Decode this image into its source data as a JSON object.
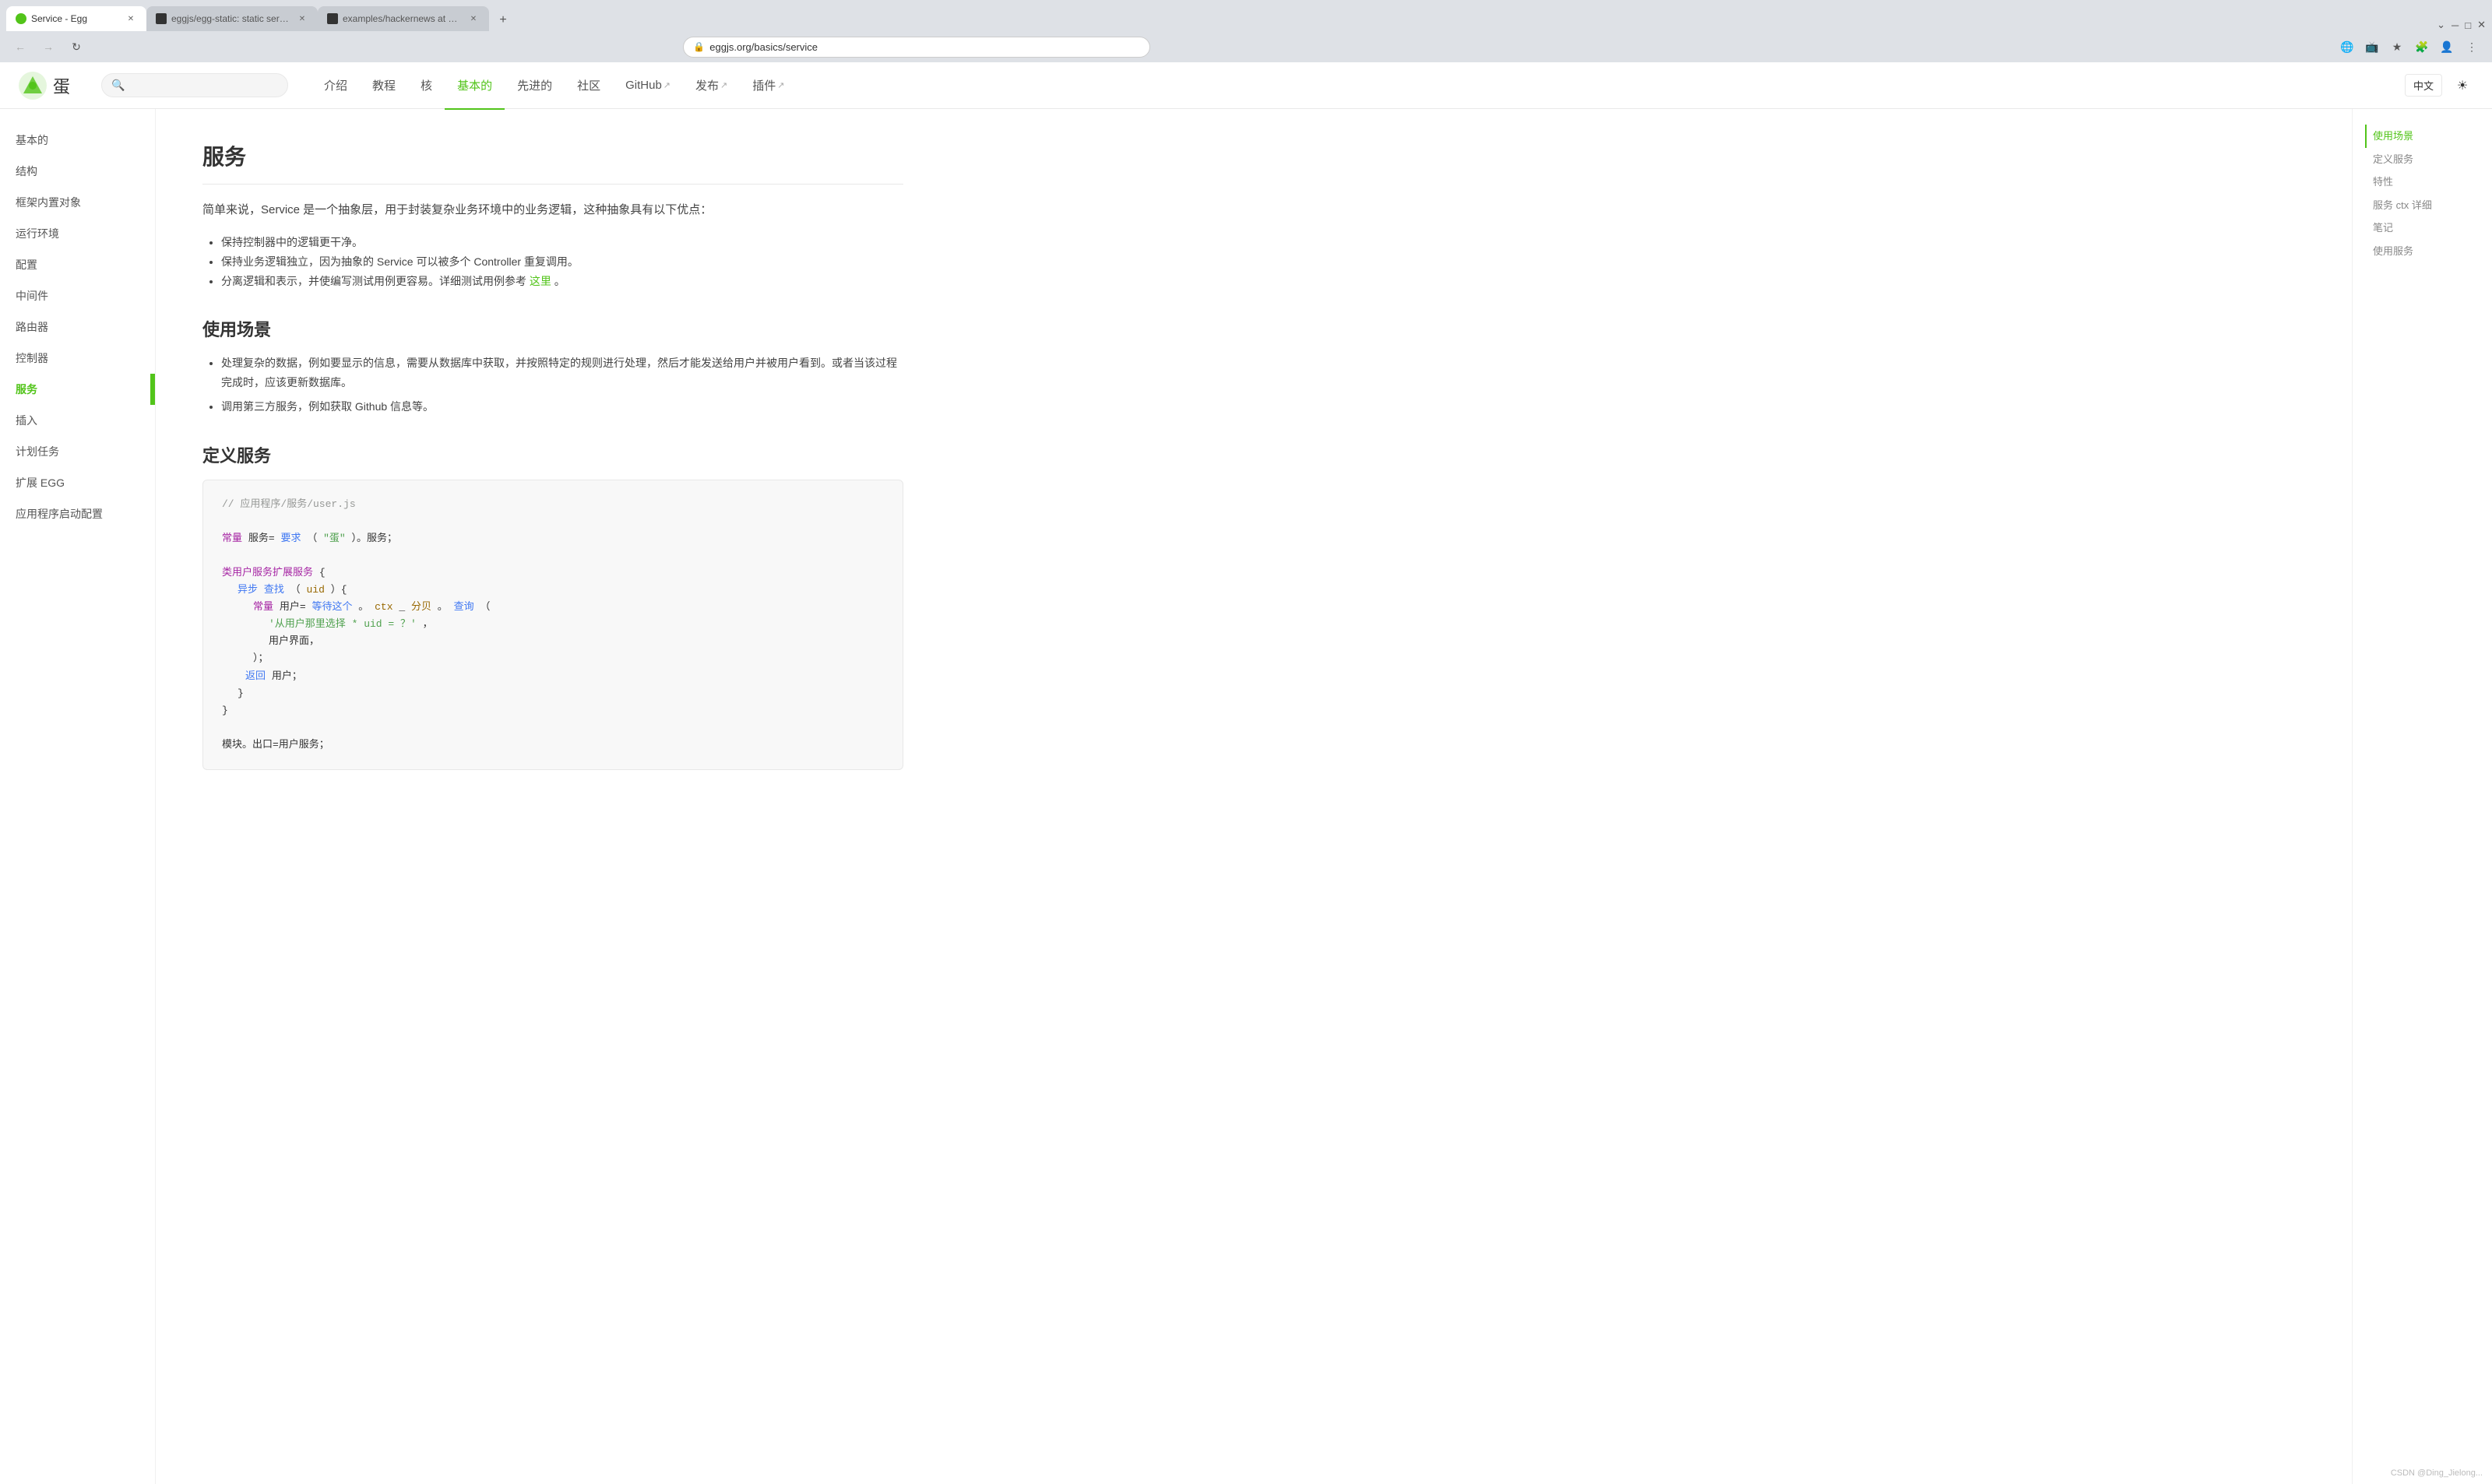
{
  "browser": {
    "tabs": [
      {
        "id": "tab1",
        "favicon_color": "#52c41a",
        "title": "Service - Egg",
        "active": true
      },
      {
        "id": "tab2",
        "favicon_color": "#333",
        "title": "eggjs/egg-static: static server",
        "active": false
      },
      {
        "id": "tab3",
        "favicon_color": "#333",
        "title": "examples/hackernews at mast...",
        "active": false
      }
    ],
    "url": "eggjs.org/basics/service",
    "new_tab_label": "+"
  },
  "nav": {
    "logo_text": "蛋",
    "search_placeholder": "",
    "links": [
      {
        "id": "intro",
        "label": "介绍",
        "active": false,
        "external": false
      },
      {
        "id": "tutorial",
        "label": "教程",
        "active": false,
        "external": false
      },
      {
        "id": "core",
        "label": "核",
        "active": false,
        "external": false
      },
      {
        "id": "basic",
        "label": "基本的",
        "active": true,
        "external": false
      },
      {
        "id": "advanced",
        "label": "先进的",
        "active": false,
        "external": false
      },
      {
        "id": "community",
        "label": "社区",
        "active": false,
        "external": false
      },
      {
        "id": "github",
        "label": "GitHub",
        "active": false,
        "external": true
      },
      {
        "id": "release",
        "label": "发布",
        "active": false,
        "external": true
      },
      {
        "id": "plugin",
        "label": "插件",
        "active": false,
        "external": true
      }
    ],
    "lang_label": "中文"
  },
  "sidebar": {
    "items": [
      {
        "id": "basic",
        "label": "基本的",
        "active": false
      },
      {
        "id": "structure",
        "label": "结构",
        "active": false
      },
      {
        "id": "framework-object",
        "label": "框架内置对象",
        "active": false
      },
      {
        "id": "runtime-env",
        "label": "运行环境",
        "active": false
      },
      {
        "id": "config",
        "label": "配置",
        "active": false
      },
      {
        "id": "middleware",
        "label": "中间件",
        "active": false
      },
      {
        "id": "router",
        "label": "路由器",
        "active": false
      },
      {
        "id": "controller",
        "label": "控制器",
        "active": false
      },
      {
        "id": "service",
        "label": "服务",
        "active": true
      },
      {
        "id": "plugin",
        "label": "插入",
        "active": false
      },
      {
        "id": "schedule",
        "label": "计划任务",
        "active": false
      },
      {
        "id": "extend-egg",
        "label": "扩展 EGG",
        "active": false
      },
      {
        "id": "app-startup",
        "label": "应用程序启动配置",
        "active": false
      }
    ]
  },
  "toc": {
    "items": [
      {
        "id": "use-scenario",
        "label": "使用场景",
        "active": true
      },
      {
        "id": "define-service",
        "label": "定义服务",
        "active": false
      },
      {
        "id": "properties",
        "label": "特性",
        "active": false
      },
      {
        "id": "service-ctx",
        "label": "服务 ctx 详细",
        "active": false
      },
      {
        "id": "notes",
        "label": "笔记",
        "active": false
      },
      {
        "id": "use-service",
        "label": "使用服务",
        "active": false
      }
    ]
  },
  "content": {
    "page_title": "服务",
    "intro": "简单来说，Service 是一个抽象层，用于封装复杂业务环境中的业务逻辑，这种抽象具有以下优点：",
    "intro_bullets": [
      "保持控制器中的逻辑更干净。",
      "保持业务逻辑独立，因为抽象的 Service 可以被多个 Controller 重复调用。",
      "分离逻辑和表示，并使编写测试用例更容易。详细测试用例参考"
    ],
    "intro_link_text": "这里",
    "intro_link_suffix": "。",
    "use_scenario_title": "使用场景",
    "use_scenario_bullets": [
      "处理复杂的数据，例如要显示的信息，需要从数据库中获取，并按照特定的规则进行处理，然后才能发送给用户并被用户看到。或者当该过程完成时，应该更新数据库。",
      "调用第三方服务，例如获取 Github 信息等。"
    ],
    "define_service_title": "定义服务",
    "code_lines": [
      {
        "type": "comment",
        "text": "// 应用程序/服务/user.js"
      },
      {
        "type": "plain",
        "text": ""
      },
      {
        "type": "keyword_const",
        "parts": [
          {
            "type": "keyword",
            "text": "常量"
          },
          {
            "type": "plain",
            "text": "服务="
          },
          {
            "type": "fn",
            "text": "要求"
          },
          {
            "type": "plain",
            "text": "（"
          },
          {
            "type": "string",
            "text": "\"蛋\""
          },
          {
            "type": "plain",
            "text": "）。服务；"
          }
        ]
      },
      {
        "type": "plain",
        "text": ""
      },
      {
        "type": "class_line",
        "parts": [
          {
            "type": "keyword",
            "text": "类用户服务扩展服务"
          },
          {
            "type": "plain",
            "text": "{"
          }
        ]
      },
      {
        "type": "method_line",
        "parts": [
          {
            "type": "keyword_blue",
            "text": "异步"
          },
          {
            "type": "plain",
            "text": " "
          },
          {
            "type": "fn",
            "text": "查找"
          },
          {
            "type": "plain",
            "text": "（"
          },
          {
            "type": "var",
            "text": "uid"
          },
          {
            "type": "plain",
            "text": "）{"
          }
        ]
      },
      {
        "type": "const_line",
        "indent": 4,
        "parts": [
          {
            "type": "keyword",
            "text": "常量"
          },
          {
            "type": "plain",
            "text": "用户="
          },
          {
            "type": "keyword_blue",
            "text": "等待这个"
          },
          {
            "type": "plain",
            "text": "。"
          },
          {
            "type": "var",
            "text": "ctx"
          },
          {
            "type": "plain",
            "text": " _ "
          },
          {
            "type": "var",
            "text": "分贝"
          },
          {
            "type": "plain",
            "text": "。"
          },
          {
            "type": "fn",
            "text": "查询"
          },
          {
            "type": "plain",
            "text": "（"
          }
        ]
      },
      {
        "type": "string_line",
        "indent": 5,
        "text": "'从用户那里选择 * uid = ？'，"
      },
      {
        "type": "plain_indent",
        "indent": 5,
        "text": "用户界面，"
      },
      {
        "type": "plain_indent",
        "indent": 4,
        "text": "）；"
      },
      {
        "type": "return_line",
        "indent": 3,
        "parts": [
          {
            "type": "keyword_blue",
            "text": "返回"
          },
          {
            "type": "plain",
            "text": "用户；"
          }
        ]
      },
      {
        "type": "plain_indent",
        "indent": 2,
        "text": "}"
      },
      {
        "type": "plain_indent",
        "indent": 1,
        "text": "}"
      },
      {
        "type": "plain",
        "text": ""
      },
      {
        "type": "export_line",
        "parts": [
          {
            "type": "plain",
            "text": "模块。出口=用户服务；"
          }
        ]
      }
    ]
  },
  "watermark": {
    "text": "CSDN @Ding_Jielong..."
  }
}
